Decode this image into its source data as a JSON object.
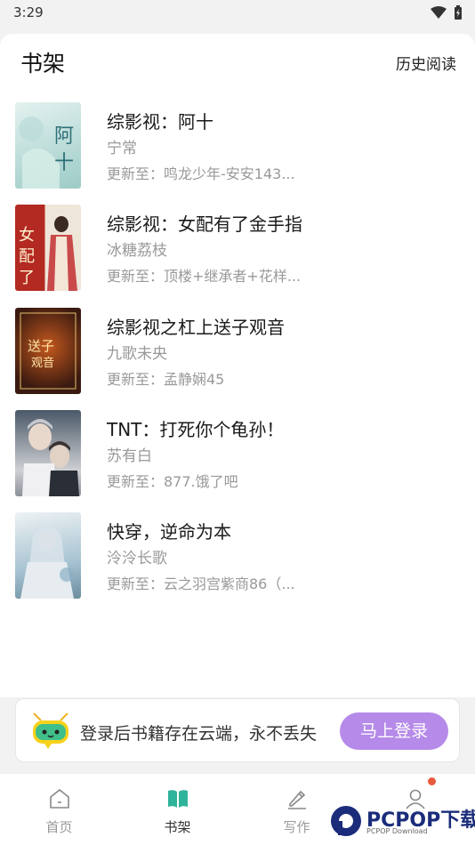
{
  "status_bar": {
    "time": "3:29",
    "icons": [
      "wifi-icon",
      "battery-charging-icon"
    ]
  },
  "header": {
    "title": "书架",
    "history_link": "历史阅读"
  },
  "books": [
    {
      "title": "综影视：阿十",
      "author": "宁常",
      "update": "更新至：鸣龙少年-安安143...",
      "cover_text": "阿十",
      "cover_colors": [
        "#cfe6e4",
        "#8fc3c0"
      ]
    },
    {
      "title": "综影视：女配有了金手指",
      "author": "冰糖荔枝",
      "update": "更新至：顶楼+继承者+花样...",
      "cover_text": "女配有了",
      "cover_colors": [
        "#b32a22",
        "#f2ece2"
      ]
    },
    {
      "title": "综影视之杠上送子观音",
      "author": "九歌未央",
      "update": "更新至：孟静娴45",
      "cover_text": "送子观音",
      "cover_colors": [
        "#3a1a10",
        "#c04a1c"
      ]
    },
    {
      "title": "TNT：打死你个龟孙！",
      "author": "苏有白",
      "update": "更新至：877.饿了吧",
      "cover_text": "",
      "cover_colors": [
        "#5a6878",
        "#d8d4d0"
      ]
    },
    {
      "title": "快穿，逆命为本",
      "author": "泠泠长歌",
      "update": "更新至：云之羽宫紫商86（...",
      "cover_text": "",
      "cover_colors": [
        "#dfe6ea",
        "#7aa4b8"
      ]
    }
  ],
  "login_banner": {
    "text": "登录后书籍存在云端，永不丢失",
    "button": "马上登录"
  },
  "bottom_nav": [
    {
      "label": "首页",
      "icon": "home-icon",
      "active": false
    },
    {
      "label": "书架",
      "icon": "open-book-icon",
      "active": true
    },
    {
      "label": "写作",
      "icon": "pen-icon",
      "active": false
    },
    {
      "label": "",
      "icon": "user-icon",
      "active": false
    }
  ],
  "watermark": {
    "text": "PCPOP下载",
    "sub": "PCPOP Download"
  },
  "colors": {
    "accent": "#b58ae8",
    "active_icon": "#2fb39a",
    "notification": "#e85a3c"
  }
}
